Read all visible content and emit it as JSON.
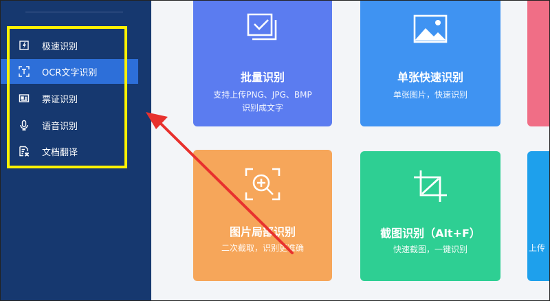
{
  "sidebar": {
    "items": [
      {
        "label": "极速识别",
        "icon": "flash-image-icon",
        "active": false
      },
      {
        "label": "OCR文字识别",
        "icon": "text-scan-icon",
        "active": true
      },
      {
        "label": "票证识别",
        "icon": "id-card-icon",
        "active": false
      },
      {
        "label": "语音识别",
        "icon": "microphone-icon",
        "active": false
      },
      {
        "label": "文档翻译",
        "icon": "document-translate-icon",
        "active": false
      }
    ],
    "highlight_color": "#fff200"
  },
  "cards": [
    {
      "title": "批量识别",
      "desc_line1": "支持上传PNG、JPG、BMP",
      "desc_line2": "识别成文字",
      "color": "#5b7cf0",
      "icon": "batch-check-icon"
    },
    {
      "title": "单张快速识别",
      "desc_line1": "单张图片，快速识别",
      "color": "#3f93f2",
      "icon": "image-icon"
    },
    {
      "title": "图片局部识别",
      "desc_line1": "二次截取，识别更准确",
      "color": "#f6a65a",
      "icon": "zoom-scan-icon"
    },
    {
      "title": "截图识别（Alt+F）",
      "desc_line1": "快速截图，一键识别",
      "color": "#2ecf93",
      "icon": "crop-icon"
    },
    {
      "title": "",
      "desc_line1": "上传",
      "color": "#1ea0ec",
      "icon": ""
    },
    {
      "title": "",
      "desc_line1": "",
      "color": "#f06e86",
      "icon": ""
    }
  ],
  "annotation": {
    "arrow_color": "#e8312e"
  }
}
